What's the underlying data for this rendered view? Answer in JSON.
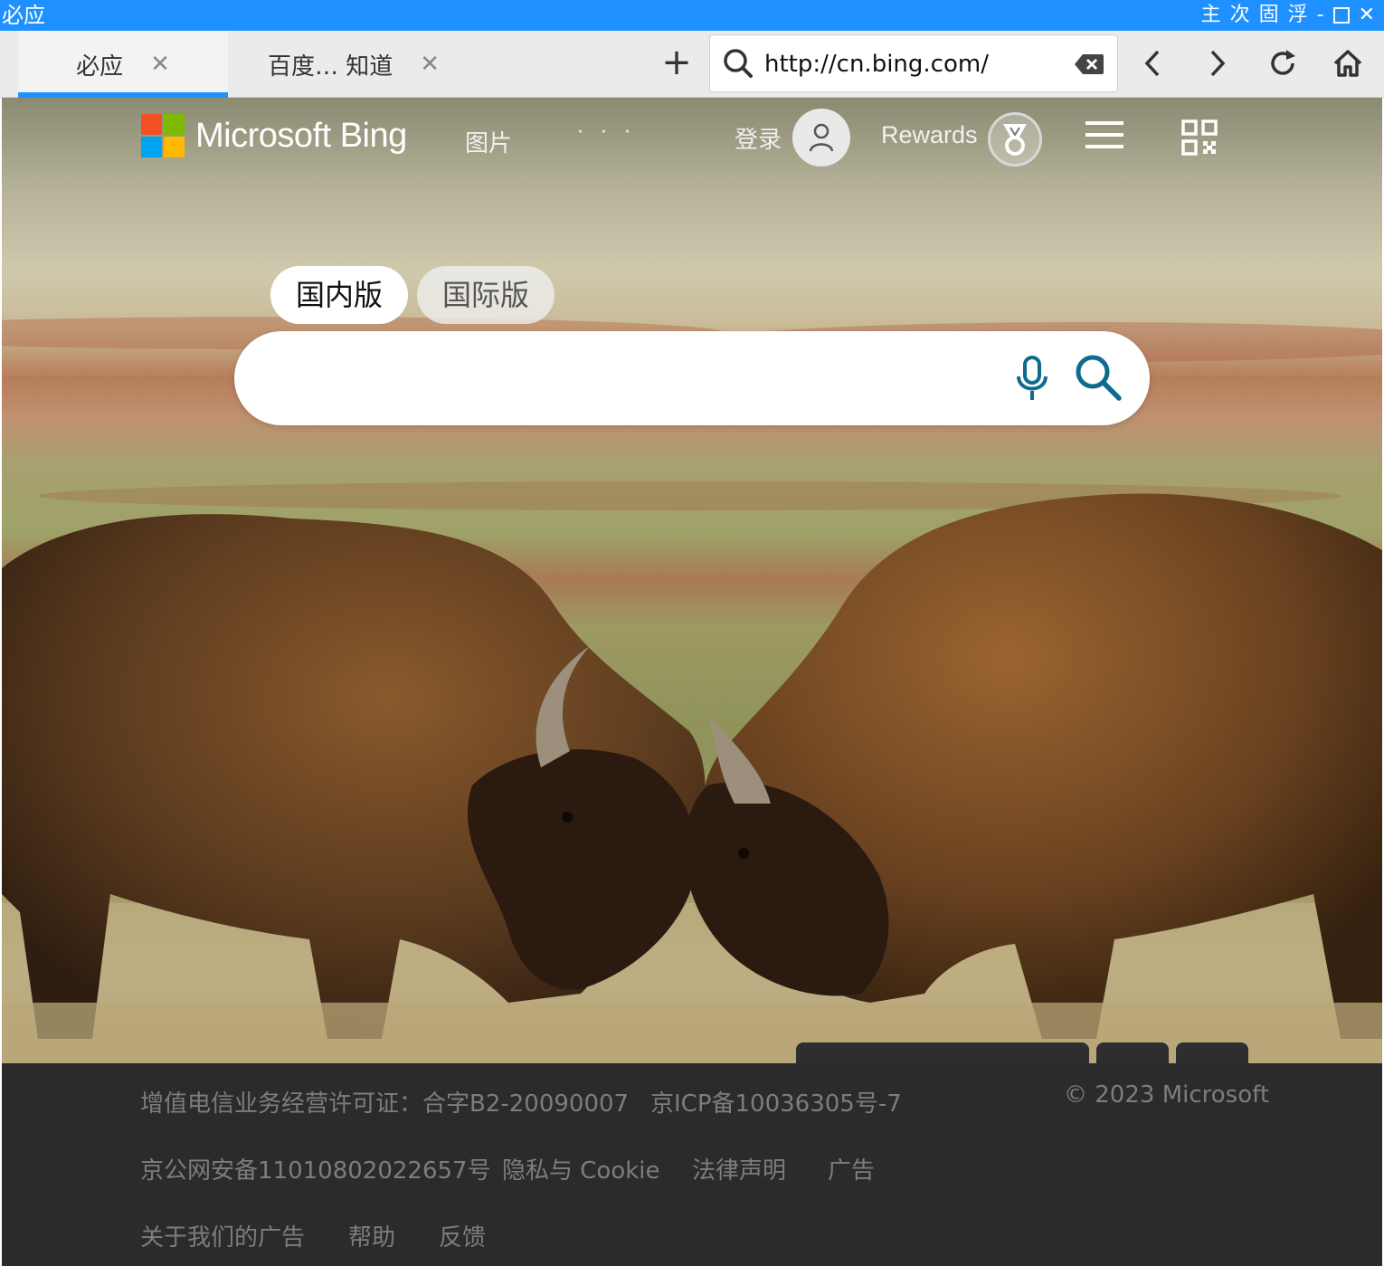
{
  "window": {
    "title": "必应",
    "controls": [
      "主",
      "次",
      "固",
      "浮",
      "-",
      "□",
      "✕"
    ]
  },
  "tabs": [
    {
      "label": "必应",
      "close": "✕"
    },
    {
      "label": "百度… 知道",
      "close": "✕"
    }
  ],
  "new_tab": "+",
  "address_bar": {
    "url": "http://cn.bing.com/"
  },
  "colors": {
    "titlebar": "#1e90ff",
    "accent_blue": "#1e90ff",
    "bing_teal": "#0f6b8e",
    "footer_bg": "#2b2b2b",
    "ms_red": "#f25022",
    "ms_green": "#7fba00",
    "ms_blue": "#00a4ef",
    "ms_yellow": "#ffb900"
  },
  "header": {
    "brand": "Microsoft Bing",
    "images": "图片",
    "more": "· · ·",
    "login": "登录",
    "rewards": "Rewards"
  },
  "region": {
    "domestic": "国内版",
    "international": "国际版"
  },
  "search": {
    "value": ""
  },
  "footer": {
    "license": "增值电信业务经营许可证：合字B2-20090007",
    "icp": "京ICP备10036305号-7",
    "copyright": "© 2023 Microsoft",
    "police": "京公网安备11010802022657号",
    "privacy": "隐私与 Cookie",
    "legal": "法律声明",
    "ads": "广告",
    "about_ads": "关于我们的广告",
    "help": "帮助",
    "feedback": "反馈"
  }
}
